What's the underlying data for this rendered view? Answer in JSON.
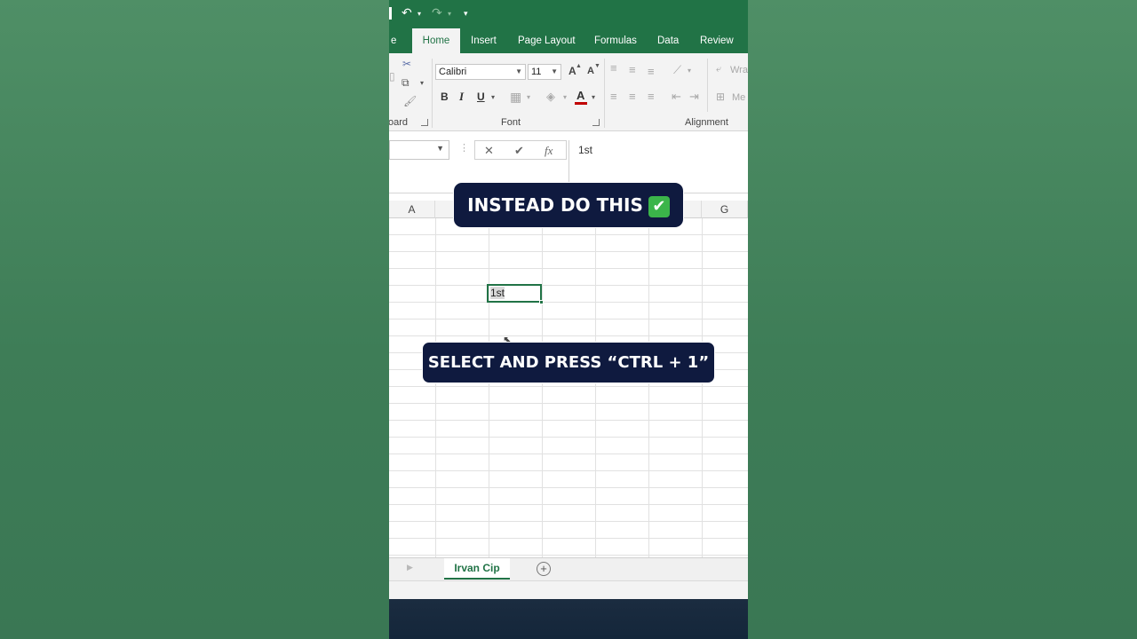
{
  "qat": {
    "undo_icon": "undo-icon",
    "redo_icon": "redo-icon",
    "customize_icon": "customize-qat-icon"
  },
  "tabs": [
    {
      "label": "e"
    },
    {
      "label": "Home"
    },
    {
      "label": "Insert"
    },
    {
      "label": "Page Layout"
    },
    {
      "label": "Formulas"
    },
    {
      "label": "Data"
    },
    {
      "label": "Review"
    }
  ],
  "ribbon": {
    "clipboard_label": "oard",
    "font_label": "Font",
    "alignment_label": "Alignment",
    "font_name": "Calibri",
    "font_size": "11",
    "wrap_partial": "Wra",
    "merge_partial": "Me",
    "bold": "B",
    "italic": "I",
    "underline": "U",
    "grow_font": "A",
    "shrink_font": "A",
    "font_color": "A"
  },
  "formula_bar": {
    "cancel": "✕",
    "enter": "✔",
    "fx": "fx",
    "value": "1st"
  },
  "columns": [
    "A",
    "G"
  ],
  "active_cell": {
    "text": "1st"
  },
  "sheet_tab": {
    "label": "Irvan Cip"
  },
  "captions": {
    "top": "INSTEAD DO THIS",
    "top_check": "✔",
    "middle": "SELECT AND PRESS “CTRL + 1”"
  },
  "colors": {
    "excel_green": "#217346",
    "caption_bg": "#0f1a3f",
    "background_green": "#3f7f58"
  }
}
